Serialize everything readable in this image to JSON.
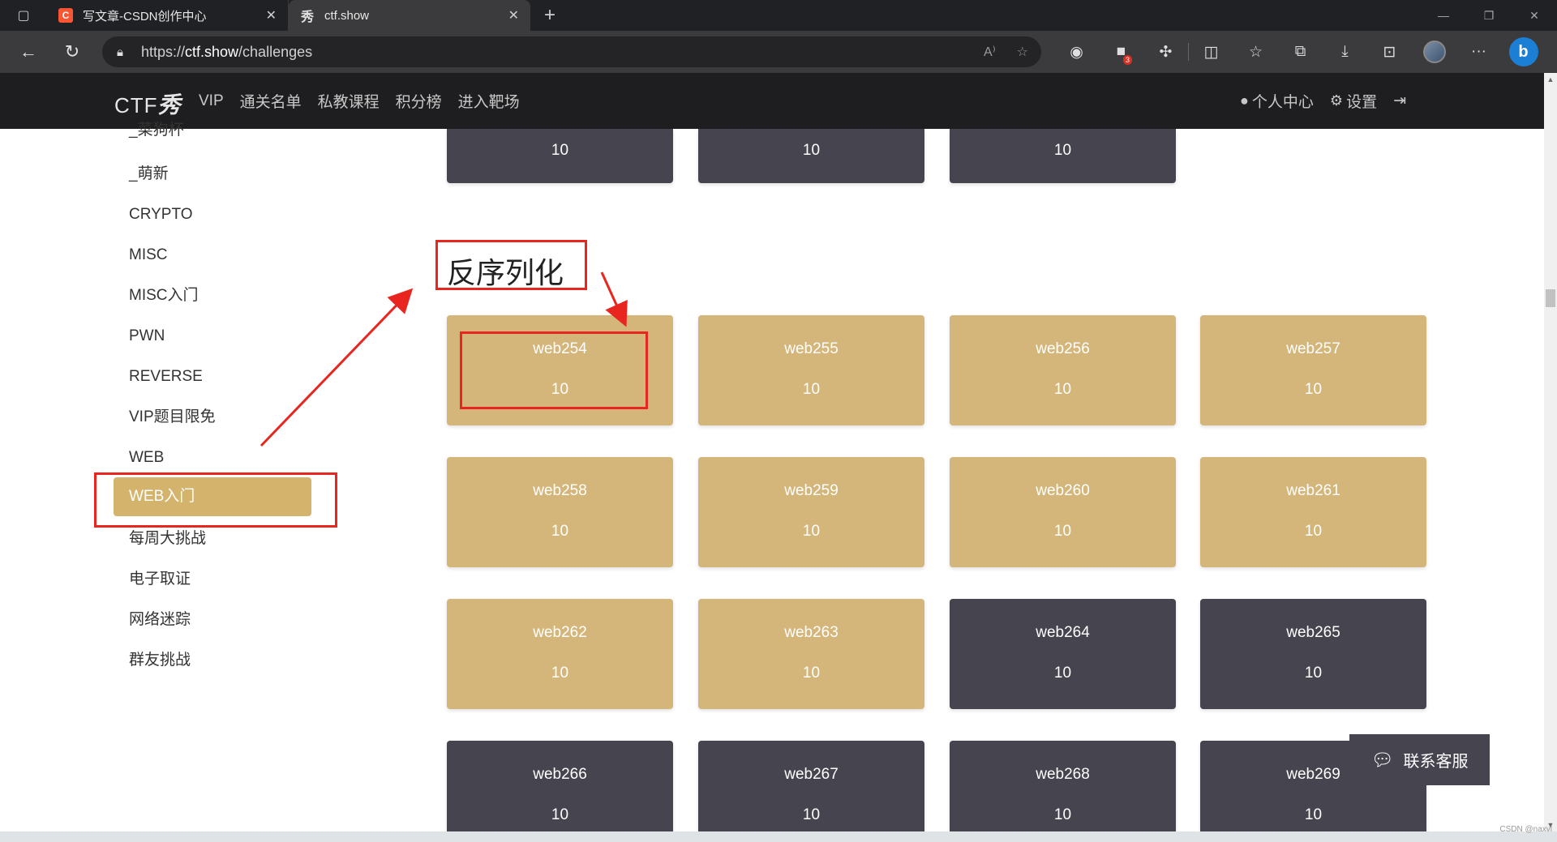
{
  "browser": {
    "tabs": [
      {
        "title": "写文章-CSDN创作中心",
        "favicon": "C",
        "active": false
      },
      {
        "title": "ctf.show",
        "favicon": "秀",
        "active": true
      }
    ],
    "url_prefix": "https://",
    "url_domain": "ctf.show",
    "url_path": "/challenges"
  },
  "site": {
    "logo_text": "CTF",
    "logo_script": "秀",
    "nav": [
      "VIP",
      "通关名单",
      "私教课程",
      "积分榜",
      "进入靶场"
    ],
    "nav_right": [
      "个人中心",
      "设置"
    ]
  },
  "sidebar": {
    "items": [
      "_菜狗杯",
      "_萌新",
      "CRYPTO",
      "MISC",
      "MISC入门",
      "PWN",
      "REVERSE",
      "VIP题目限免",
      "WEB",
      "WEB入门",
      "每周大挑战",
      "电子取证",
      "网络迷踪",
      "群友挑战"
    ],
    "active": "WEB入门"
  },
  "top_cards": [
    {
      "points": "10"
    },
    {
      "points": "10"
    },
    {
      "points": "10"
    }
  ],
  "section": {
    "title": "反序列化"
  },
  "cards": [
    {
      "name": "web254",
      "points": "10",
      "status": "solved"
    },
    {
      "name": "web255",
      "points": "10",
      "status": "solved"
    },
    {
      "name": "web256",
      "points": "10",
      "status": "solved"
    },
    {
      "name": "web257",
      "points": "10",
      "status": "solved"
    },
    {
      "name": "web258",
      "points": "10",
      "status": "solved"
    },
    {
      "name": "web259",
      "points": "10",
      "status": "solved"
    },
    {
      "name": "web260",
      "points": "10",
      "status": "solved"
    },
    {
      "name": "web261",
      "points": "10",
      "status": "solved"
    },
    {
      "name": "web262",
      "points": "10",
      "status": "solved"
    },
    {
      "name": "web263",
      "points": "10",
      "status": "solved"
    },
    {
      "name": "web264",
      "points": "10",
      "status": "unsolved"
    },
    {
      "name": "web265",
      "points": "10",
      "status": "unsolved"
    },
    {
      "name": "web266",
      "points": "10",
      "status": "unsolved"
    },
    {
      "name": "web267",
      "points": "10",
      "status": "unsolved"
    },
    {
      "name": "web268",
      "points": "10",
      "status": "unsolved"
    },
    {
      "name": "web269",
      "points": "10",
      "status": "unsolved"
    }
  ],
  "customer_service": {
    "label": "联系客服"
  },
  "extensions_badge": "3",
  "watermark": "CSDN @naxvl",
  "colors": {
    "solved": "#d5b67a",
    "unsolved": "#45444f",
    "active_side": "#d4b46d",
    "annotation": "#e8251f"
  }
}
